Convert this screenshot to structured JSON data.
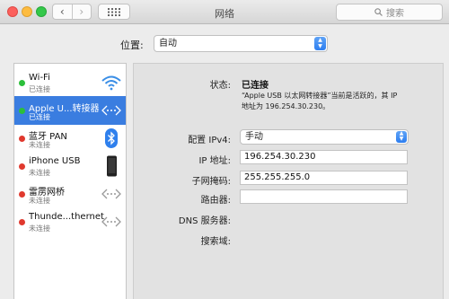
{
  "window": {
    "title": "网络",
    "search_placeholder": "搜索"
  },
  "location": {
    "label": "位置:",
    "value": "自动"
  },
  "services": [
    {
      "name": "Wi-Fi",
      "status": "已连接",
      "status_color": "green",
      "icon": "wifi-icon",
      "selected": false
    },
    {
      "name": "Apple U...转接器",
      "status": "已连接",
      "status_color": "green",
      "icon": "ethernet-icon",
      "selected": true
    },
    {
      "name": "蓝牙 PAN",
      "status": "未连接",
      "status_color": "red",
      "icon": "bluetooth-icon",
      "selected": false
    },
    {
      "name": "iPhone USB",
      "status": "未连接",
      "status_color": "red",
      "icon": "iphone-icon",
      "selected": false
    },
    {
      "name": "雷雳网桥",
      "status": "未连接",
      "status_color": "red",
      "icon": "ethernet-icon",
      "selected": false
    },
    {
      "name": "Thunde...thernet",
      "status": "未连接",
      "status_color": "red",
      "icon": "ethernet-icon",
      "selected": false
    }
  ],
  "detail": {
    "status_label": "状态:",
    "status_value": "已连接",
    "status_desc_line1": "“Apple USB 以太网转接器”当前是活跃的，其 IP",
    "status_desc_line2": "地址为 196.254.30.230。",
    "configure_label": "配置 IPv4:",
    "configure_value": "手动",
    "ip_label": "IP 地址:",
    "ip_value": "196.254.30.230",
    "subnet_label": "子网掩码:",
    "subnet_value": "255.255.255.0",
    "router_label": "路由器:",
    "router_value": "",
    "dns_label": "DNS 服务器:",
    "search_domain_label": "搜索域:"
  },
  "colors": {
    "selection": "#3a7de0",
    "status_green": "#2cbf3a",
    "status_red": "#e0392e"
  }
}
